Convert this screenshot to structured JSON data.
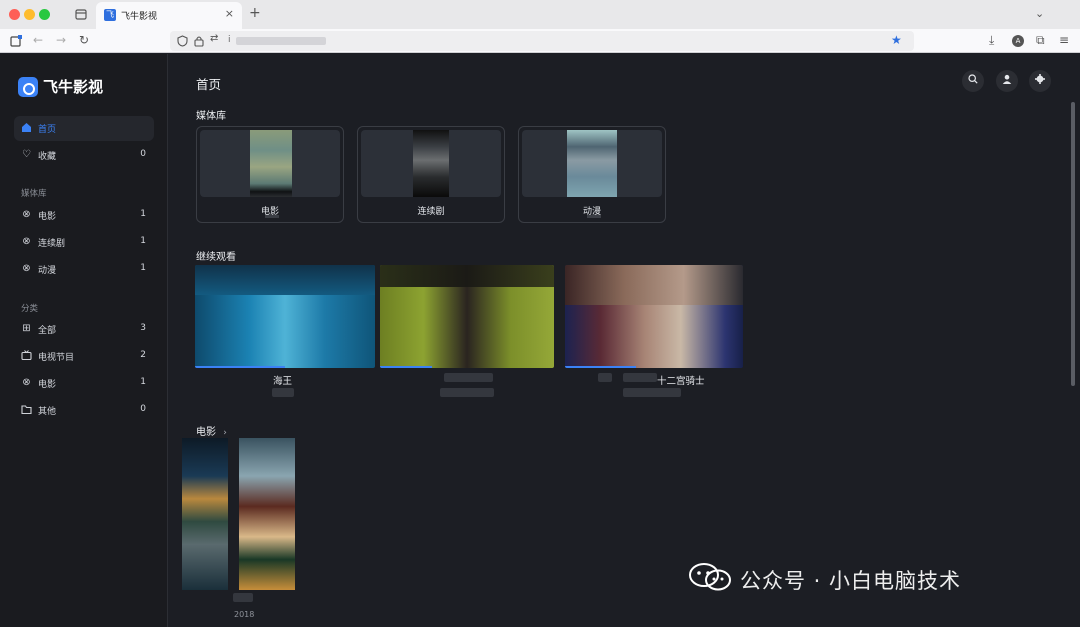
{
  "browser": {
    "tab_title": "飞牛影视",
    "tab_favicon_text": "飞",
    "url_prefix": "i",
    "colors": {
      "window_red": "#fe5f57",
      "window_yellow": "#febc2e",
      "window_green": "#28c840",
      "accent": "#3b82f6"
    }
  },
  "app": {
    "name": "飞牛影视"
  },
  "sidebar": {
    "primary": [
      {
        "label": "首页",
        "count": "",
        "icon": "home-icon",
        "active": true
      },
      {
        "label": "收藏",
        "count": "0",
        "icon": "heart-icon"
      }
    ],
    "library_section_label": "媒体库",
    "library": [
      {
        "label": "电影",
        "count": "1",
        "icon": "film-reel-icon"
      },
      {
        "label": "连续剧",
        "count": "1",
        "icon": "film-reel-icon"
      },
      {
        "label": "动漫",
        "count": "1",
        "icon": "film-reel-icon"
      }
    ],
    "category_section_label": "分类",
    "categories": [
      {
        "label": "全部",
        "count": "3",
        "icon": "grid-icon"
      },
      {
        "label": "电视节目",
        "count": "2",
        "icon": "tv-icon"
      },
      {
        "label": "电影",
        "count": "1",
        "icon": "film-reel-icon"
      },
      {
        "label": "其他",
        "count": "0",
        "icon": "folder-icon"
      }
    ]
  },
  "main": {
    "title": "首页",
    "media_library_heading": "媒体库",
    "libraries": [
      {
        "label": "电影"
      },
      {
        "label": "连续剧"
      },
      {
        "label": "动漫"
      }
    ],
    "continue_heading": "继续观看",
    "continue": [
      {
        "title": "海王"
      },
      {
        "title": ""
      },
      {
        "title": "十二宫骑士"
      }
    ],
    "movies_heading": "电影",
    "movies_heading_chevron": "›",
    "movies": [
      {
        "year": ""
      },
      {
        "year": "2018"
      }
    ]
  },
  "watermark": {
    "text": "公众号 · 小白电脑技术"
  }
}
